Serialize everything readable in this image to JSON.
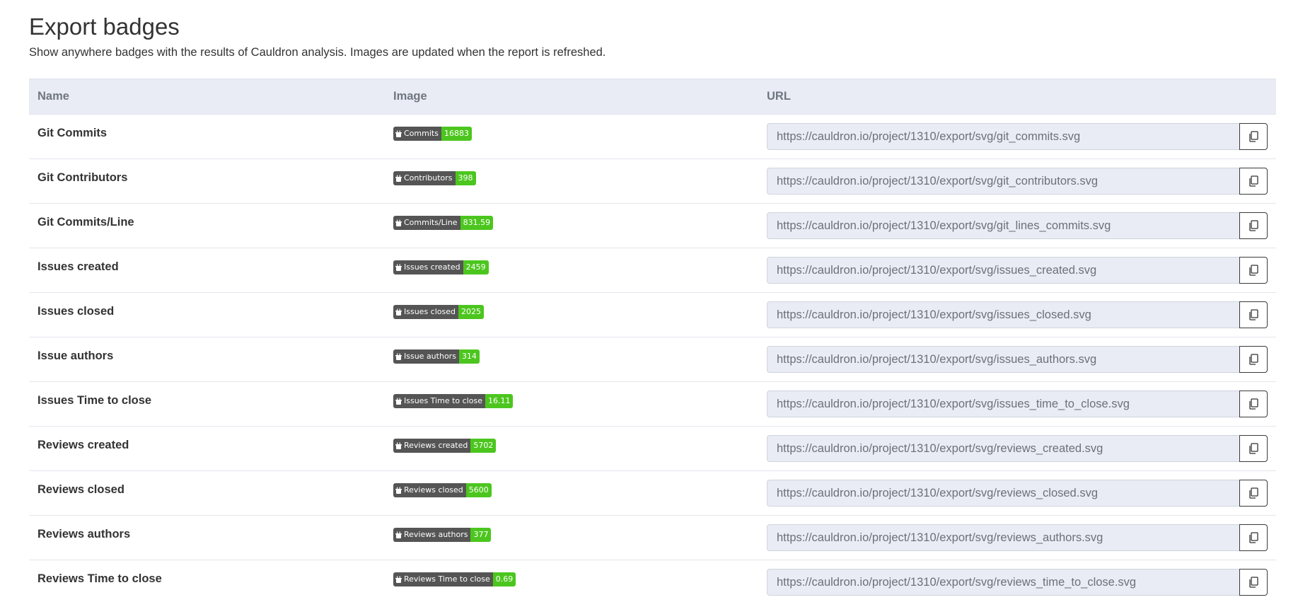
{
  "page": {
    "title": "Export badges",
    "subtitle": "Show anywhere badges with the results of Cauldron analysis. Images are updated when the report is refreshed."
  },
  "table": {
    "headers": {
      "name": "Name",
      "image": "Image",
      "url": "URL"
    },
    "rows": [
      {
        "name": "Git Commits",
        "badge_label": "Commits",
        "badge_value": "16883",
        "url": "https://cauldron.io/project/1310/export/svg/git_commits.svg"
      },
      {
        "name": "Git Contributors",
        "badge_label": "Contributors",
        "badge_value": "398",
        "url": "https://cauldron.io/project/1310/export/svg/git_contributors.svg"
      },
      {
        "name": "Git Commits/Line",
        "badge_label": "Commits/Line",
        "badge_value": "831.59",
        "url": "https://cauldron.io/project/1310/export/svg/git_lines_commits.svg"
      },
      {
        "name": "Issues created",
        "badge_label": "Issues created",
        "badge_value": "2459",
        "url": "https://cauldron.io/project/1310/export/svg/issues_created.svg"
      },
      {
        "name": "Issues closed",
        "badge_label": "Issues closed",
        "badge_value": "2025",
        "url": "https://cauldron.io/project/1310/export/svg/issues_closed.svg"
      },
      {
        "name": "Issue authors",
        "badge_label": "Issue authors",
        "badge_value": "314",
        "url": "https://cauldron.io/project/1310/export/svg/issues_authors.svg"
      },
      {
        "name": "Issues Time to close",
        "badge_label": "Issues Time to close",
        "badge_value": "16.11",
        "url": "https://cauldron.io/project/1310/export/svg/issues_time_to_close.svg"
      },
      {
        "name": "Reviews created",
        "badge_label": "Reviews created",
        "badge_value": "5702",
        "url": "https://cauldron.io/project/1310/export/svg/reviews_created.svg"
      },
      {
        "name": "Reviews closed",
        "badge_label": "Reviews closed",
        "badge_value": "5600",
        "url": "https://cauldron.io/project/1310/export/svg/reviews_closed.svg"
      },
      {
        "name": "Reviews authors",
        "badge_label": "Reviews authors",
        "badge_value": "377",
        "url": "https://cauldron.io/project/1310/export/svg/reviews_authors.svg"
      },
      {
        "name": "Reviews Time to close",
        "badge_label": "Reviews Time to close",
        "badge_value": "0.69",
        "url": "https://cauldron.io/project/1310/export/svg/reviews_time_to_close.svg"
      }
    ]
  },
  "icons": {
    "badge": "cauldron-icon",
    "copy": "copy-icon"
  },
  "colors": {
    "header_bg": "#e9ecf5",
    "badge_label_bg": "#555555",
    "badge_value_bg": "#4cc61e",
    "input_bg": "#e9ecf5"
  }
}
